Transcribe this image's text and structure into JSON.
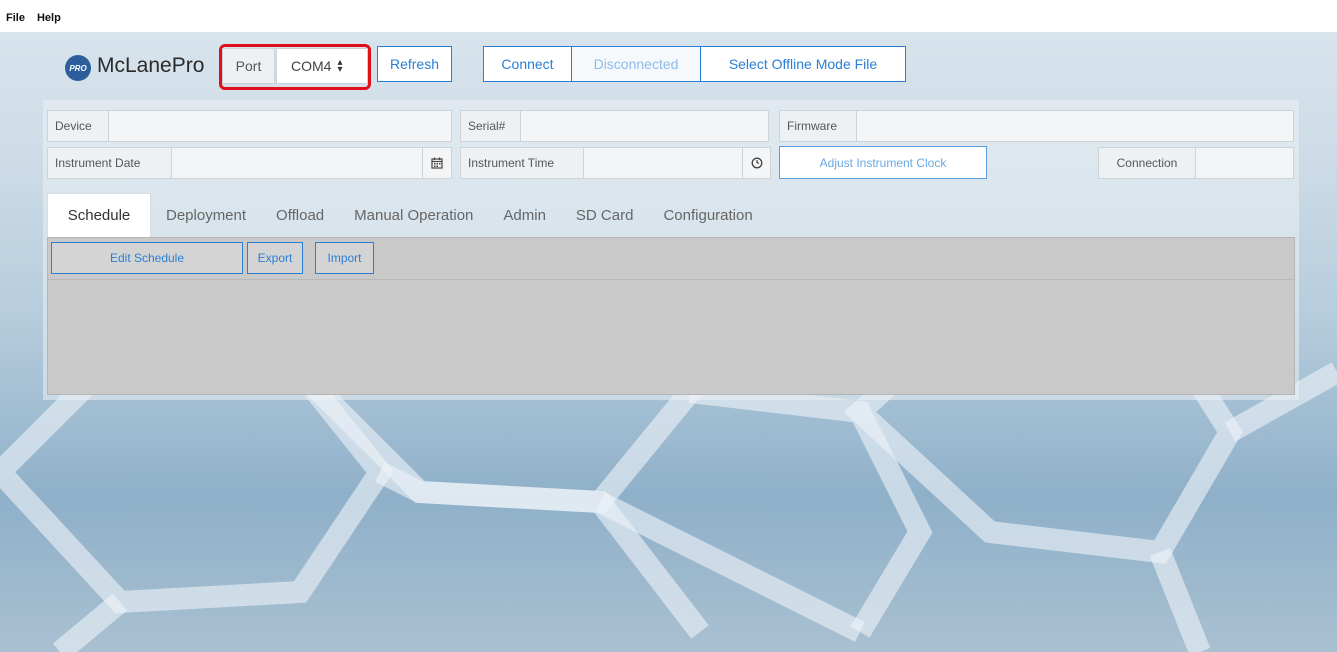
{
  "menu": {
    "file": "File",
    "help": "Help"
  },
  "brand": {
    "badge": "PRO",
    "name": "McLanePro"
  },
  "port": {
    "label": "Port",
    "selected": "COM4",
    "arrows": "▲▼"
  },
  "buttons": {
    "refresh": "Refresh",
    "connect": "Connect",
    "status": "Disconnected",
    "offline": "Select Offline Mode File",
    "adjust_clock": "Adjust Instrument Clock"
  },
  "fields": {
    "device": {
      "label": "Device",
      "value": ""
    },
    "serial": {
      "label": "Serial#",
      "value": ""
    },
    "firmware": {
      "label": "Firmware",
      "value": ""
    },
    "instrument_date": {
      "label": "Instrument Date",
      "value": ""
    },
    "instrument_time": {
      "label": "Instrument Time",
      "value": ""
    },
    "connection": {
      "label": "Connection",
      "value": ""
    }
  },
  "icons": {
    "calendar": "calendar-icon",
    "clock": "clock-icon"
  },
  "tabs": [
    {
      "label": "Schedule",
      "active": true
    },
    {
      "label": "Deployment",
      "active": false
    },
    {
      "label": "Offload",
      "active": false
    },
    {
      "label": "Manual Operation",
      "active": false
    },
    {
      "label": "Admin",
      "active": false
    },
    {
      "label": "SD Card",
      "active": false
    },
    {
      "label": "Configuration",
      "active": false
    }
  ],
  "schedule": {
    "edit": "Edit Schedule",
    "export": "Export",
    "import": "Import"
  },
  "colors": {
    "accent": "#2b7fd4",
    "highlight": "#e0101a",
    "brand": "#2c5e9c"
  }
}
